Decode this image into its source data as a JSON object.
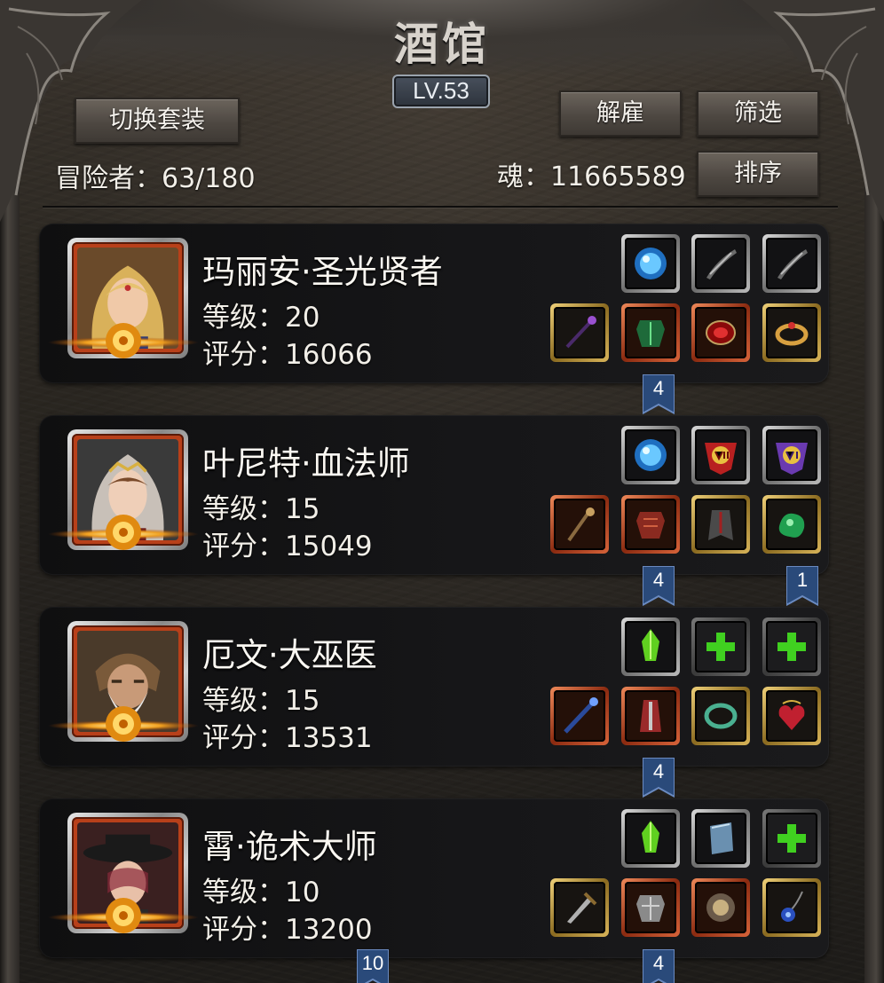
{
  "header": {
    "title": "酒馆",
    "level": "LV.53",
    "switch_outfit_label": "切换套装",
    "dismiss_label": "解雇",
    "filter_label": "筛选",
    "sort_label": "排序",
    "adventurers": "冒险者：63/180",
    "souls": "魂：11665589"
  },
  "heroes": [
    {
      "name": "玛丽安·圣光贤者",
      "level": "等级：20",
      "score": "评分：16066",
      "top_slots": [
        "blue-orb-icon",
        "curved-blade-icon",
        "curved-blade-icon"
      ],
      "bottom_slots": [
        "staff-icon",
        "green-armor-icon",
        "red-gem-icon",
        "gold-ring-icon"
      ],
      "tags": [
        {
          "text": "4"
        }
      ]
    },
    {
      "name": "叶尼特·血法师",
      "level": "等级：15",
      "score": "评分：15049",
      "top_slots": [
        "blue-orb-icon",
        "emblem-vii-icon",
        "emblem-vi-icon"
      ],
      "bottom_slots": [
        "staff-icon",
        "red-armor-icon",
        "cloak-icon",
        "green-gem-icon"
      ],
      "tags": [
        {
          "text": "4"
        },
        {
          "text": "1"
        }
      ]
    },
    {
      "name": "厄文·大巫医",
      "level": "等级：15",
      "score": "评分：13531",
      "top_slots": [
        "green-crystal-icon",
        "plus-icon",
        "plus-icon"
      ],
      "bottom_slots": [
        "blue-staff-icon",
        "red-robe-icon",
        "jade-ring-icon",
        "heart-amulet-icon"
      ],
      "tags": [
        {
          "text": "4"
        }
      ]
    },
    {
      "name": "霄·诡术大师",
      "level": "等级：10",
      "score": "评分：13200",
      "top_slots": [
        "green-crystal-icon",
        "book-icon",
        "plus-icon"
      ],
      "bottom_slots": [
        "dagger-icon",
        "silver-armor-icon",
        "stone-amulet-icon",
        "blue-amulet-icon"
      ],
      "tags": [
        {
          "text": "10"
        },
        {
          "text": "4"
        }
      ]
    }
  ]
}
